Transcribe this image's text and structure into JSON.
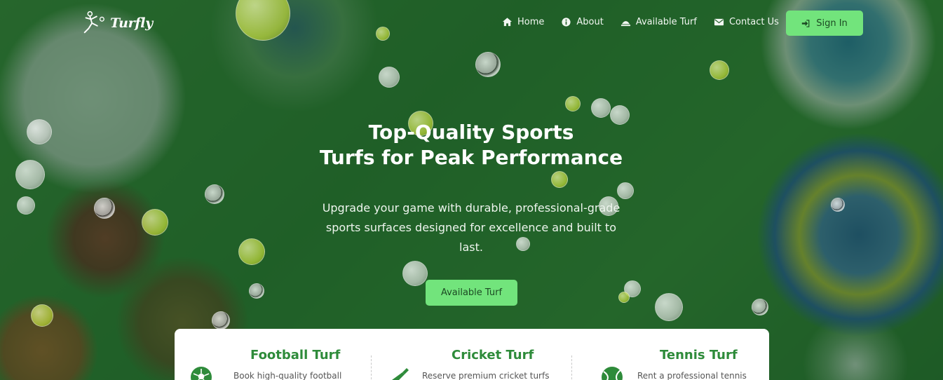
{
  "brand": {
    "name": "Turfly"
  },
  "nav": {
    "items": [
      {
        "label": "Home",
        "icon": "home-icon"
      },
      {
        "label": "About",
        "icon": "info-icon"
      },
      {
        "label": "Available Turf",
        "icon": "turf-icon"
      },
      {
        "label": "Contact Us",
        "icon": "envelope-icon"
      }
    ],
    "signin_label": "Sign In",
    "signin_icon": "sign-in-icon"
  },
  "hero": {
    "title_line1": "Top-Quality Sports",
    "title_line2": "Turfs for Peak Performance",
    "subtitle": "Upgrade your game with durable, professional-grade sports surfaces designed for excellence and built to last.",
    "cta_label": "Available Turf"
  },
  "cards": [
    {
      "title": "Football Turf",
      "desc": "Book high-quality football",
      "icon": "football-icon"
    },
    {
      "title": "Cricket Turf",
      "desc": "Reserve premium cricket turfs",
      "icon": "cricket-bat-icon"
    },
    {
      "title": "Tennis Turf",
      "desc": "Rent a professional tennis",
      "icon": "tennis-ball-icon"
    }
  ],
  "colors": {
    "accent": "#72e47c",
    "card_title": "#2e8b3a",
    "overlay": "#144b23"
  }
}
